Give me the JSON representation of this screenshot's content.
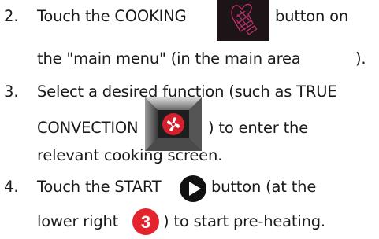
{
  "steps": [
    {
      "number": "2.",
      "line1_pre": "Touch the COOKING",
      "line1_post": "button on",
      "line2_pre": "the \"main menu\" (in the main area",
      "line2_post": ")."
    },
    {
      "number": "3.",
      "line1": "Select a desired function (such as TRUE",
      "line2_pre": "CONVECTION",
      "line2_post": ") to enter the",
      "line3": "relevant cooking screen."
    },
    {
      "number": "4.",
      "line1_pre": "Touch the START",
      "line1_post": "button (at the",
      "line2_pre": "lower right",
      "line2_post": ") to start pre-heating."
    }
  ],
  "icons": {
    "cooking": "cooking-mitt-icon",
    "convection": "true-convection-fan-icon",
    "start": "start-play-icon",
    "badge_label": "3"
  },
  "colors": {
    "cooking_bg": "#1c1416",
    "cooking_line": "#b8336a",
    "fan_bg": "#2b2b2b",
    "fan_red": "#d2202f",
    "badge_red": "#e4242d"
  }
}
